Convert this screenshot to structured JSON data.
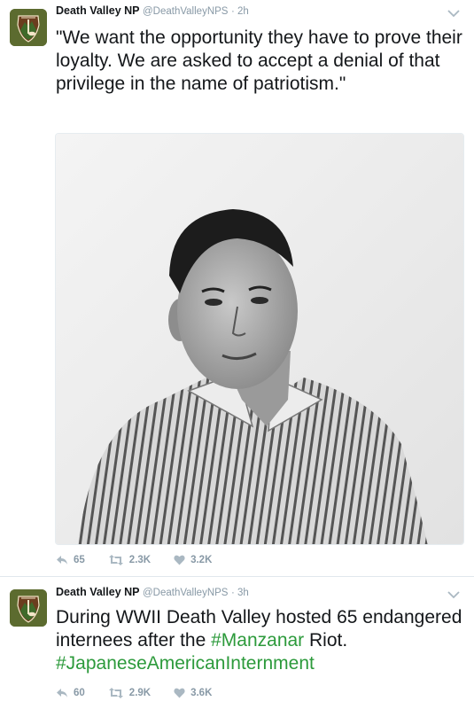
{
  "tweets": [
    {
      "author_name": "Death Valley NP",
      "handle": "@DeathValleyNPS",
      "time": "· 2h",
      "text": "\"We want the opportunity they have to prove their loyalty. We are asked to accept a denial of that privilege in the name of patriotism.\"",
      "replies": "65",
      "retweets": "2.3K",
      "likes": "3.2K"
    },
    {
      "author_name": "Death Valley NP",
      "handle": "@DeathValleyNPS",
      "time": "· 3h",
      "text_before": "During WWII Death Valley hosted 65 endangered internees after the ",
      "hashtag1": "#Manzanar",
      "text_middle": " Riot. ",
      "hashtag2": "#JapaneseAmericanInternment",
      "replies": "60",
      "retweets": "2.9K",
      "likes": "3.6K"
    }
  ],
  "colors": {
    "hashtag": "#2c9a3b",
    "muted": "#8899a6",
    "avatar_bg": "#5c6b2f"
  },
  "icons": [
    "nps-arrowhead-logo",
    "reply-icon",
    "retweet-icon",
    "heart-icon",
    "chevron-down-icon"
  ]
}
